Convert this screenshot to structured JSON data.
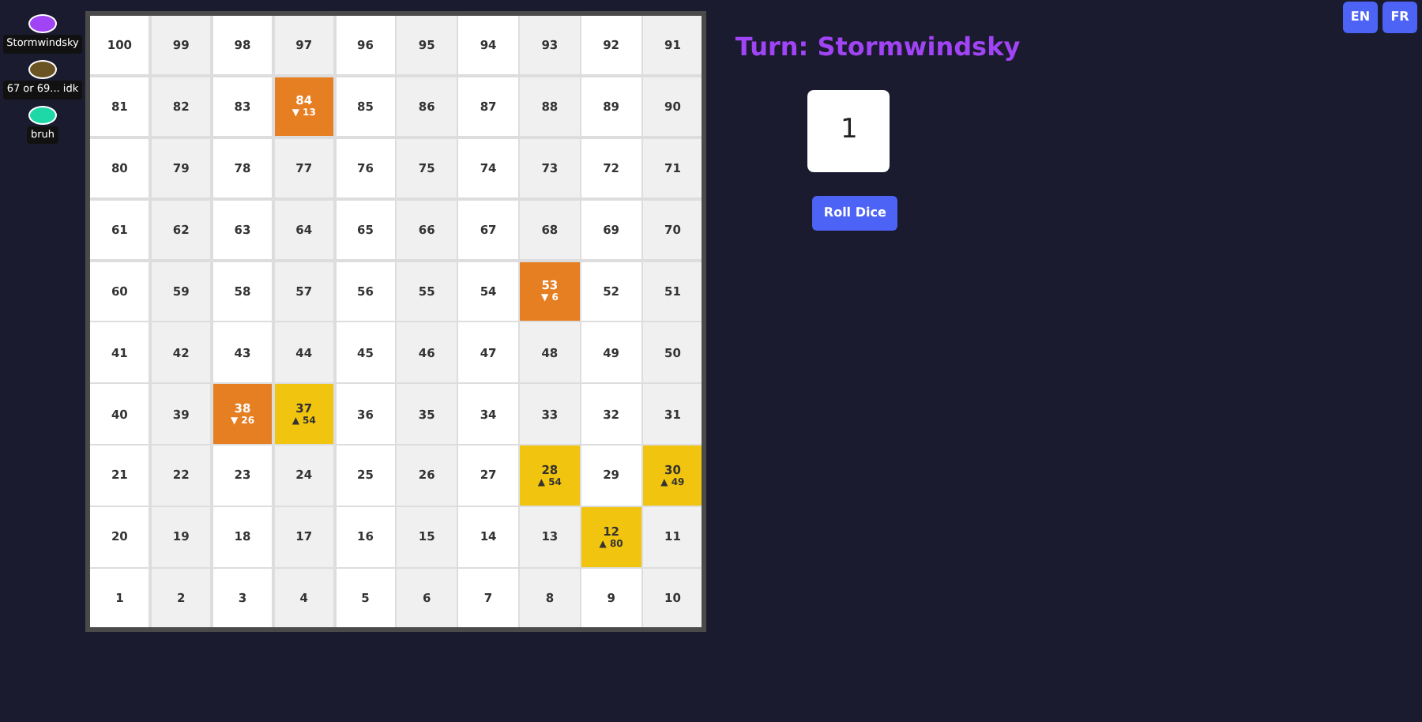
{
  "languages": [
    {
      "label": "EN"
    },
    {
      "label": "FR"
    }
  ],
  "players": [
    {
      "name": "Stormwindsky",
      "color": "#a044f5"
    },
    {
      "name": "67 or 69... idk",
      "color": "#6b5424"
    },
    {
      "name": "bruh",
      "color": "#1fd8a8"
    }
  ],
  "board": [
    [
      {
        "number": "100"
      },
      {
        "number": "99"
      },
      {
        "number": "98"
      },
      {
        "number": "97"
      },
      {
        "number": "96"
      },
      {
        "number": "95"
      },
      {
        "number": "94"
      },
      {
        "number": "93"
      },
      {
        "number": "92"
      },
      {
        "number": "91"
      }
    ],
    [
      {
        "number": "81"
      },
      {
        "number": "82"
      },
      {
        "number": "83"
      },
      {
        "number": "84",
        "kind": "snake",
        "target": "▼ 13"
      },
      {
        "number": "85"
      },
      {
        "number": "86"
      },
      {
        "number": "87"
      },
      {
        "number": "88"
      },
      {
        "number": "89"
      },
      {
        "number": "90"
      }
    ],
    [
      {
        "number": "80"
      },
      {
        "number": "79"
      },
      {
        "number": "78"
      },
      {
        "number": "77"
      },
      {
        "number": "76"
      },
      {
        "number": "75"
      },
      {
        "number": "74"
      },
      {
        "number": "73"
      },
      {
        "number": "72"
      },
      {
        "number": "71"
      }
    ],
    [
      {
        "number": "61"
      },
      {
        "number": "62"
      },
      {
        "number": "63"
      },
      {
        "number": "64"
      },
      {
        "number": "65"
      },
      {
        "number": "66"
      },
      {
        "number": "67"
      },
      {
        "number": "68"
      },
      {
        "number": "69"
      },
      {
        "number": "70"
      }
    ],
    [
      {
        "number": "60"
      },
      {
        "number": "59"
      },
      {
        "number": "58"
      },
      {
        "number": "57"
      },
      {
        "number": "56"
      },
      {
        "number": "55"
      },
      {
        "number": "54"
      },
      {
        "number": "53",
        "kind": "snake",
        "target": "▼ 6"
      },
      {
        "number": "52"
      },
      {
        "number": "51"
      }
    ],
    [
      {
        "number": "41"
      },
      {
        "number": "42"
      },
      {
        "number": "43"
      },
      {
        "number": "44"
      },
      {
        "number": "45"
      },
      {
        "number": "46"
      },
      {
        "number": "47"
      },
      {
        "number": "48"
      },
      {
        "number": "49"
      },
      {
        "number": "50"
      }
    ],
    [
      {
        "number": "40"
      },
      {
        "number": "39"
      },
      {
        "number": "38",
        "kind": "snake",
        "target": "▼ 26"
      },
      {
        "number": "37",
        "kind": "ladder",
        "target": "▲ 54"
      },
      {
        "number": "36"
      },
      {
        "number": "35"
      },
      {
        "number": "34"
      },
      {
        "number": "33"
      },
      {
        "number": "32"
      },
      {
        "number": "31"
      }
    ],
    [
      {
        "number": "21"
      },
      {
        "number": "22"
      },
      {
        "number": "23"
      },
      {
        "number": "24"
      },
      {
        "number": "25"
      },
      {
        "number": "26"
      },
      {
        "number": "27"
      },
      {
        "number": "28",
        "kind": "ladder",
        "target": "▲ 54"
      },
      {
        "number": "29"
      },
      {
        "number": "30",
        "kind": "ladder",
        "target": "▲ 49"
      }
    ],
    [
      {
        "number": "20"
      },
      {
        "number": "19"
      },
      {
        "number": "18"
      },
      {
        "number": "17"
      },
      {
        "number": "16"
      },
      {
        "number": "15"
      },
      {
        "number": "14"
      },
      {
        "number": "13"
      },
      {
        "number": "12",
        "kind": "ladder",
        "target": "▲ 80"
      },
      {
        "number": "11"
      }
    ],
    [
      {
        "number": "1"
      },
      {
        "number": "2"
      },
      {
        "number": "3"
      },
      {
        "number": "4"
      },
      {
        "number": "5"
      },
      {
        "number": "6"
      },
      {
        "number": "7"
      },
      {
        "number": "8"
      },
      {
        "number": "9"
      },
      {
        "number": "10"
      }
    ]
  ],
  "turn": {
    "label": "Turn: Stormwindsky",
    "color": "#a044f5"
  },
  "dice": {
    "value": "1"
  },
  "roll_button": "Roll Dice"
}
